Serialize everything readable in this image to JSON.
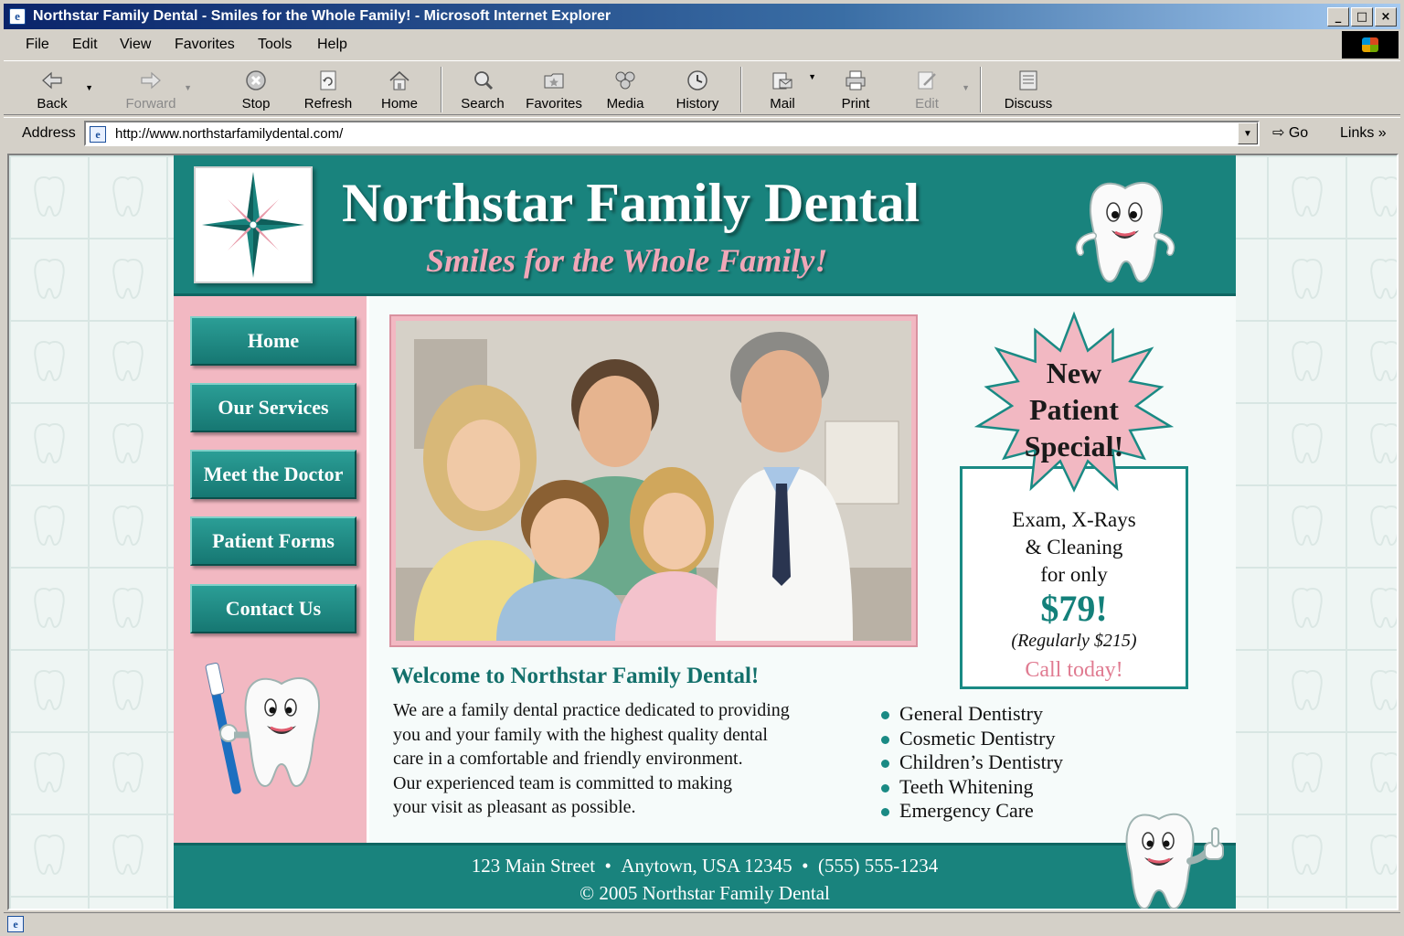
{
  "window": {
    "title": "Northstar Family Dental - Smiles for the Whole Family! - Microsoft Internet Explorer",
    "controls": [
      "_",
      "□",
      "×"
    ]
  },
  "menu": [
    "File",
    "Edit",
    "View",
    "Favorites",
    "Tools",
    "Help"
  ],
  "toolbar": {
    "back": "Back",
    "forward": "Forward",
    "stop": "Stop",
    "refresh": "Refresh",
    "home": "Home",
    "search": "Search",
    "favorites": "Favorites",
    "media": "Media",
    "history": "History",
    "mail": "Mail",
    "print": "Print",
    "edit": "Edit",
    "discuss": "Discuss"
  },
  "address": {
    "label": "Address",
    "url": "http://www.northstarfamilydental.com/",
    "go": "Go",
    "links": "Links"
  },
  "site": {
    "title": "Northstar Family Dental",
    "tagline": "Smiles for the Whole Family!",
    "brand_teal": "#19837d",
    "brand_pink": "#f2b8c2"
  },
  "nav": [
    {
      "label": "Home"
    },
    {
      "label": "Our Services"
    },
    {
      "label": "Meet the Doctor"
    },
    {
      "label": "Patient Forms"
    },
    {
      "label": "Contact Us"
    }
  ],
  "welcome": {
    "title": "Welcome to Northstar Family Dental!",
    "lines": [
      "We are a family dental practice dedicated to providing",
      "you and your family with the highest quality dental",
      "care in a comfortable and friendly environment.",
      "Our experienced team is committed to making",
      "your visit as pleasant as possible."
    ]
  },
  "special": {
    "burst": [
      "New",
      "Patient",
      "Special!"
    ],
    "offer_lines": [
      "Exam, X-Rays",
      "& Cleaning",
      "for only"
    ],
    "price": "$79!",
    "regular": "(Regularly $215)",
    "cta": "Call today!"
  },
  "services": [
    "General Dentistry",
    "Cosmetic Dentistry",
    "Children’s Dentistry",
    "Teeth Whitening",
    "Emergency Care"
  ],
  "footer": {
    "street": "123 Main Street",
    "city": "Anytown, USA 12345",
    "phone": "(555) 555-1234",
    "separator": "•",
    "copyright": "© 2005 Northstar Family Dental"
  },
  "icons": {
    "page_icon": "ie-page-icon",
    "logo": "compass-star-logo",
    "mascot": "smiling-tooth-mascot"
  }
}
